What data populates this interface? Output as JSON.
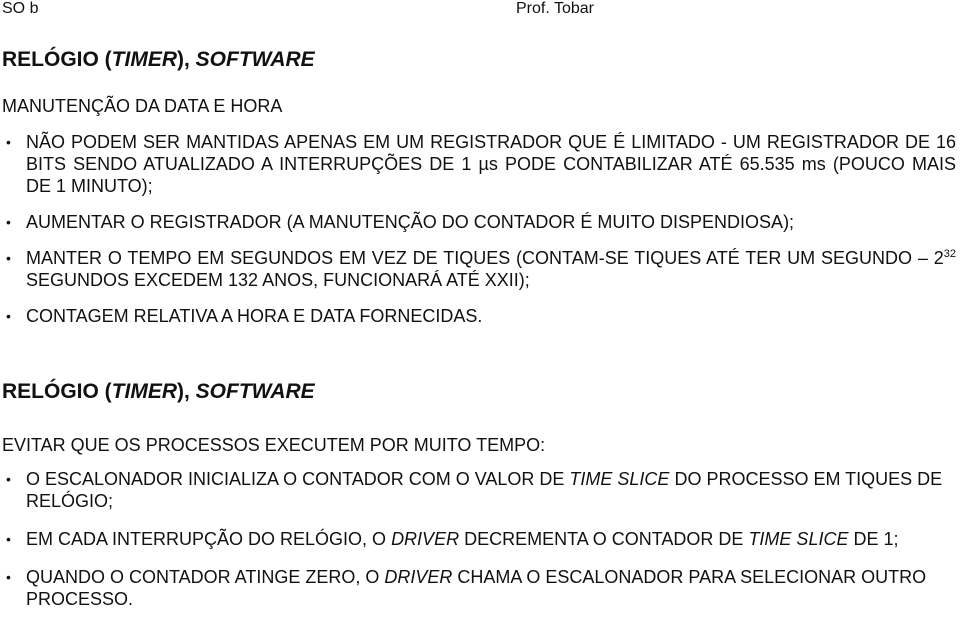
{
  "header": {
    "left": "SO b",
    "right": "Prof. Tobar"
  },
  "section1": {
    "title_prefix": "RELÓGIO (",
    "title_italic1": "TIMER",
    "title_mid": "), ",
    "title_italic2": "SOFTWARE",
    "subheading": "MANUTENÇÃO DA DATA E HORA",
    "bullets": [
      {
        "text": "NÃO PODEM SER MANTIDAS APENAS EM UM REGISTRADOR QUE É LIMITADO - UM REGISTRADOR DE 16 BITS SENDO ATUALIZADO A INTERRUPÇÕES DE 1 µs PODE CONTABILIZAR ATÉ 65.535 ms (POUCO MAIS DE 1 MINUTO);"
      },
      {
        "text": "AUMENTAR O REGISTRADOR (A MANUTENÇÃO DO CONTADOR É MUITO DISPENDIOSA);"
      },
      {
        "text_before": "MANTER O TEMPO EM SEGUNDOS EM VEZ DE TIQUES (CONTAM-SE TIQUES ATÉ TER UM SEGUNDO – 2",
        "sup": "32",
        "text_after": " SEGUNDOS EXCEDEM 132 ANOS, FUNCIONARÁ ATÉ XXII);"
      },
      {
        "text": "CONTAGEM RELATIVA A HORA E DATA FORNECIDAS."
      }
    ]
  },
  "section2": {
    "title_prefix": "RELÓGIO (",
    "title_italic1": "TIMER",
    "title_mid": "), ",
    "title_italic2": "SOFTWARE",
    "subheading": "EVITAR QUE OS PROCESSOS EXECUTEM POR MUITO TEMPO:",
    "bullets": [
      {
        "a": "O ESCALONADOR INICIALIZA O CONTADOR COM O VALOR DE ",
        "b_italic": "TIME SLICE",
        "c": " DO PROCESSO EM TIQUES DE RELÓGIO;"
      },
      {
        "a": "EM CADA INTERRUPÇÃO DO RELÓGIO, O ",
        "b_italic": "DRIVER",
        "c": " DECREMENTA O CONTADOR DE ",
        "d_italic": "TIME SLICE",
        "e": " DE 1;"
      },
      {
        "a": "QUANDO O CONTADOR ATINGE ZERO, O ",
        "b_italic": "DRIVER",
        "c": " CHAMA O ESCALONADOR PARA SELECIONAR OUTRO PROCESSO."
      }
    ]
  },
  "bullet_glyph": "•"
}
